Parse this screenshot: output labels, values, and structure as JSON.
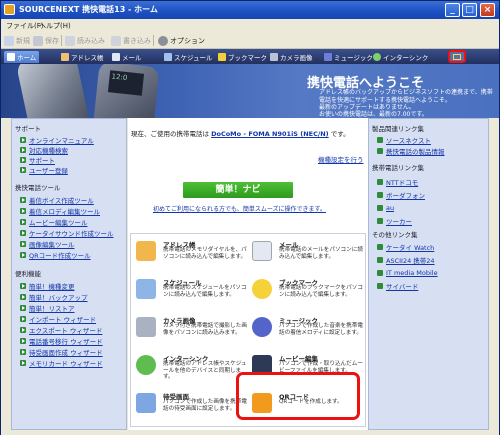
{
  "window": {
    "title": "SOURCENEXT 携快電話13 - ホーム",
    "minimize": "_",
    "maximize": "□",
    "close": "×"
  },
  "menu": [
    "ファイル(F)",
    "ヘルプ(H)"
  ],
  "toolbar": {
    "items": [
      {
        "label": "新規",
        "enabled": false
      },
      {
        "label": "保存",
        "enabled": false
      },
      {
        "label": "読み込み",
        "enabled": false
      },
      {
        "label": "書き込み",
        "enabled": false
      },
      {
        "label": "オプション",
        "enabled": true
      }
    ]
  },
  "nav_tabs": [
    {
      "label": "ホーム",
      "icon": "house-icon",
      "active": true
    },
    {
      "label": "アドレス帳",
      "icon": "address-book-icon",
      "active": false
    },
    {
      "label": "メール",
      "icon": "mail-icon",
      "active": false
    },
    {
      "label": "スケジュール",
      "icon": "calendar-icon",
      "active": false
    },
    {
      "label": "ブックマーク",
      "icon": "star-icon",
      "active": false
    },
    {
      "label": "カメラ画像",
      "icon": "camera-icon",
      "active": false
    },
    {
      "label": "ミュージック",
      "icon": "music-icon",
      "active": false
    },
    {
      "label": "インターシンク",
      "icon": "sync-icon",
      "active": false
    }
  ],
  "banner": {
    "phone_screen": "12:0",
    "welcome": "携快電話へようこそ",
    "description": "アドレス帳のバックアップからビジネスソフトの連携まで、携帯電話を快適にサポートする携快電話へようこそ。",
    "news_line1": "最新のアップデートはありません。",
    "news_line2": "お使いの携快電話は、最新の7.00です。"
  },
  "left_panel": {
    "sections": [
      {
        "title": "サポート",
        "items": [
          "オンラインマニュアル",
          "対応機種検索",
          "サポート",
          "ユーザー登録"
        ]
      },
      {
        "title": "携快電話ツール",
        "items": [
          "着信ボイス作成ツール",
          "着信メロディ編集ツール",
          "ムービー編集ツール",
          "ケータイサウンド作成ツール",
          "画像編集ツール",
          "QRコード作成ツール"
        ]
      },
      {
        "title": "便利機能",
        "items": [
          "簡単！機種変更",
          "簡単！バックアップ",
          "簡単！リストア",
          "インポート ウィザード",
          "エクスポート ウィザード",
          "電話番号移行 ウィザード",
          "待受画面作成 ウィザード",
          "メモリカード ウィザード"
        ]
      }
    ]
  },
  "center": {
    "current_prefix": "現在、ご使用の携帯電話は",
    "current_model": "DoCoMo - FOMA N901iS (NEC/N)",
    "current_suffix": "です。",
    "model_settings_link": "機種設定を行う",
    "navi_button": "簡単！ナビ",
    "navi_link": "初めてご利用になられる方でも、簡単スムーズに操作できます。",
    "functions": [
      {
        "title": "アドレス帳",
        "desc": "携帯電話のメモリダイヤルを、パソコンに読み込んで編集します。",
        "icon": "address-book-icon"
      },
      {
        "title": "メール",
        "desc": "携帯電話のメールをパソコンに読み込んで編集します。",
        "icon": "mail-icon"
      },
      {
        "title": "スケジュール",
        "desc": "携帯電話のスケジュールをパソコンに読み込んで編集します。",
        "icon": "calendar-icon"
      },
      {
        "title": "ブックマーク",
        "desc": "携帯電話のブックマークをパソコンに読み込んで編集します。",
        "icon": "star-icon"
      },
      {
        "title": "カメラ画像",
        "desc": "カメラ付き携帯電話で撮影した画像をパソコンに読み込みます。",
        "icon": "camera-icon"
      },
      {
        "title": "ミュージック",
        "desc": "パソコンで作成した音楽を携帯電話の着信メロディに設定します。",
        "icon": "music-icon"
      },
      {
        "title": "インターシンク",
        "desc": "携帯電話のアドレス帳やスケジュールを他のデバイスと同期します。",
        "icon": "sync-icon"
      },
      {
        "title": "ムービー編集",
        "desc": "パソコンで作成・取り込んだムービーファイルを編集します。",
        "icon": "film-icon"
      },
      {
        "title": "待受画面",
        "desc": "パソコンで作成した画像を携帯電話の待受画面に設定します。",
        "icon": "screen-icon"
      },
      {
        "title": "QRコード",
        "desc": "QRコードを作成します。",
        "icon": "qr-icon"
      }
    ]
  },
  "right_panel": {
    "sections": [
      {
        "title": "製品関連リンク集",
        "items": [
          "ソースネクスト",
          "携快電話の製品情報"
        ]
      },
      {
        "title": "携帯電話リンク集",
        "items": [
          "NTTドコモ",
          "ボーダフォン",
          "au",
          "ツーカー"
        ]
      },
      {
        "title": "その他リンク集",
        "items": [
          "ケータイ Watch",
          "ASCII24 携帯24",
          "IT media Mobile",
          "サイバード"
        ]
      }
    ]
  },
  "colors": {
    "title_bar": "#1c4fc0",
    "nav_bar": "#22305e",
    "link": "#1336a8",
    "navi_button": "#2d9a1d",
    "highlight": "#e11111"
  }
}
